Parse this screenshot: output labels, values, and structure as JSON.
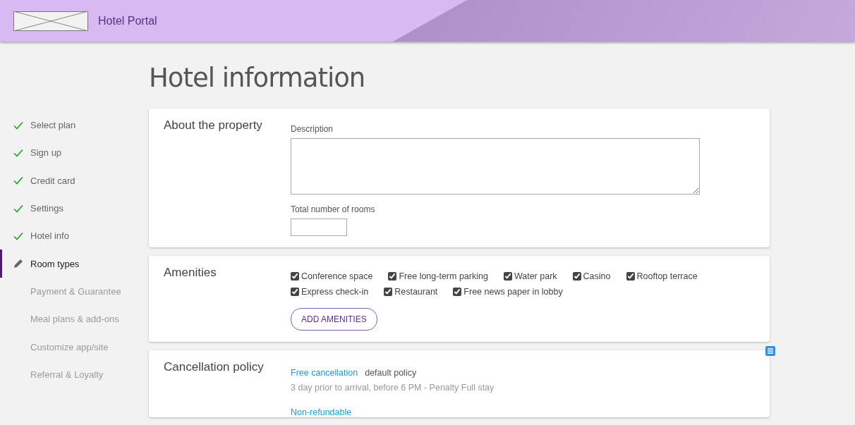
{
  "header": {
    "title": "Hotel Portal"
  },
  "sidebar": {
    "items": [
      {
        "label": "Select plan",
        "kind": "done",
        "selected": false
      },
      {
        "label": "Sign up",
        "kind": "done",
        "selected": false
      },
      {
        "label": "Credit card",
        "kind": "done",
        "selected": false
      },
      {
        "label": "Settings",
        "kind": "done",
        "selected": false
      },
      {
        "label": "Hotel info",
        "kind": "done",
        "selected": false
      },
      {
        "label": "Room types",
        "kind": "current",
        "selected": true
      },
      {
        "label": "Payment & Guarantee",
        "kind": "pending",
        "selected": false
      },
      {
        "label": "Meal plans & add-ons",
        "kind": "pending",
        "selected": false
      },
      {
        "label": "Customize app/site",
        "kind": "pending",
        "selected": false
      },
      {
        "label": "Referral & Loyalty",
        "kind": "pending",
        "selected": false
      }
    ]
  },
  "page_title": "Hotel information",
  "about": {
    "heading": "About the property",
    "description_label": "Description",
    "rooms_label": "Total number of rooms"
  },
  "amenities": {
    "heading": "Amenities",
    "items": [
      {
        "label": "Conference space",
        "checked": true
      },
      {
        "label": "Free long-term parking",
        "checked": true
      },
      {
        "label": "Water park",
        "checked": true
      },
      {
        "label": "Casino",
        "checked": true
      },
      {
        "label": "Rooftop terrace",
        "checked": true
      },
      {
        "label": "Express check-in",
        "checked": true
      },
      {
        "label": "Restaurant",
        "checked": true
      },
      {
        "label": "Free news paper in lobby",
        "checked": true
      }
    ],
    "button": "ADD AMENITIES"
  },
  "cancellation": {
    "heading": "Cancellation policy",
    "policies": [
      {
        "name": "Free cancellation",
        "tag": "default policy",
        "detail": "3 day prior to arrival, before 6 PM - Penalty Full stay"
      },
      {
        "name": "Non-refundable"
      }
    ]
  }
}
